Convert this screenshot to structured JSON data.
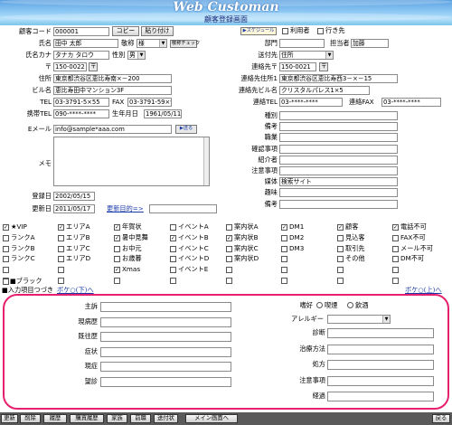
{
  "header": {
    "app_title": "Web Customan",
    "screen_title": "顧客登録画面"
  },
  "customer": {
    "code_label": "顧客コード",
    "code": "000001",
    "copy_button": "コピー",
    "paste_button": "貼り付け",
    "name_label": "氏名",
    "name": "田中 太郎",
    "honorific_label": "敬称",
    "honorific": "様",
    "honorific_check_button": "敬称チェック",
    "kana_label": "氏名カナ",
    "kana": "タナカ タロウ",
    "gender_label": "性別",
    "gender": "男",
    "postal_mark": "〒",
    "postal": "150-0022",
    "postal_button": "〒",
    "address_label": "住所",
    "address": "東京都渋谷区恵比寿南×－200",
    "building_label": "ビル名",
    "building": "恵比寿田中マンション3F",
    "tel_label": "TEL",
    "tel": "03-3791-5×55",
    "fax_label": "FAX",
    "fax": "03-3791-59×9",
    "mobile_label": "携帯TEL",
    "mobile": "090-****-****",
    "birthday_label": "生年月日",
    "birthday": "1961/05/11",
    "email_label": "Eメール",
    "email": "info@sample*aaa.com",
    "email_button": "▶送る",
    "memo_label": "メモ",
    "memo": "",
    "registered_label": "登録日",
    "registered": "2002/05/15",
    "updated_label": "更新日",
    "updated": "2011/05/17",
    "update_purpose_link": "更新目的=>",
    "update_purpose": ""
  },
  "right": {
    "schedule_button": "▶スケジュール",
    "user_checkbox": "利用者",
    "destination_checkbox": "行き先",
    "department_label": "部門",
    "department": "",
    "staff_label": "担当者",
    "staff": "加藤",
    "delivery_label": "送付先",
    "delivery": "住所",
    "contact_postal_label": "連絡先〒",
    "contact_postal": "150-0021",
    "contact_postal_button": "〒",
    "contact_address_label": "連絡先住所1",
    "contact_address": "東京都渋谷区恵比寿西3－×－15",
    "contact_building_label": "連絡先ビル名",
    "contact_building": "クリスタルパレス1×5",
    "contact_tel_label": "連絡TEL",
    "contact_tel": "03-****-****",
    "contact_fax_label": "連絡FAX",
    "contact_fax": "03-****-****",
    "fields": [
      {
        "label": "種別",
        "value": ""
      },
      {
        "label": "備考",
        "value": ""
      },
      {
        "label": "職業",
        "value": ""
      },
      {
        "label": "確認事項",
        "value": ""
      },
      {
        "label": "紹介者",
        "value": ""
      },
      {
        "label": "注意事項",
        "value": ""
      },
      {
        "label": "媒体",
        "value": "検索サイト"
      },
      {
        "label": "趣味",
        "value": ""
      },
      {
        "label": "備考",
        "value": ""
      }
    ]
  },
  "checks": [
    [
      {
        "label": "★VIP",
        "checked": true
      },
      {
        "label": "エリアA",
        "checked": true
      },
      {
        "label": "年賀状",
        "checked": true
      },
      {
        "label": "イベントA",
        "checked": false
      },
      {
        "label": "案内状A",
        "checked": false
      },
      {
        "label": "DM1",
        "checked": true
      },
      {
        "label": "顧客",
        "checked": true
      },
      {
        "label": "電話不可",
        "checked": true
      }
    ],
    [
      {
        "label": "ランクA",
        "checked": false
      },
      {
        "label": "エリアB",
        "checked": false
      },
      {
        "label": "暑中見舞",
        "checked": true
      },
      {
        "label": "イベントB",
        "checked": true
      },
      {
        "label": "案内状B",
        "checked": true
      },
      {
        "label": "DM2",
        "checked": false
      },
      {
        "label": "見込客",
        "checked": false
      },
      {
        "label": "FAX不可",
        "checked": false
      }
    ],
    [
      {
        "label": "ランクB",
        "checked": false
      },
      {
        "label": "エリアC",
        "checked": false
      },
      {
        "label": "お中元",
        "checked": false
      },
      {
        "label": "イベントC",
        "checked": false
      },
      {
        "label": "案内状C",
        "checked": false
      },
      {
        "label": "DM3",
        "checked": false
      },
      {
        "label": "取引先",
        "checked": false
      },
      {
        "label": "メール不可",
        "checked": false
      }
    ],
    [
      {
        "label": "ランクC",
        "checked": false
      },
      {
        "label": "エリアD",
        "checked": false
      },
      {
        "label": "お歳暮",
        "checked": false
      },
      {
        "label": "イベントD",
        "checked": false
      },
      {
        "label": "案内状D",
        "checked": false
      },
      {
        "label": "",
        "checked": false
      },
      {
        "label": "その他",
        "checked": false
      },
      {
        "label": "DM不可",
        "checked": false
      }
    ],
    [
      {
        "label": "",
        "checked": false
      },
      {
        "label": "",
        "checked": false
      },
      {
        "label": "Xmas",
        "checked": true
      },
      {
        "label": "イベントE",
        "checked": false
      },
      {
        "label": "",
        "checked": false
      },
      {
        "label": "",
        "checked": false
      },
      {
        "label": "",
        "checked": false
      },
      {
        "label": "",
        "checked": false
      }
    ],
    [
      {
        "label": "",
        "checked": false
      },
      {
        "label": "",
        "checked": false
      },
      {
        "label": "",
        "checked": false
      },
      {
        "label": "",
        "checked": false
      },
      {
        "label": "",
        "checked": false
      },
      {
        "label": "",
        "checked": false
      },
      {
        "label": "",
        "checked": false
      },
      {
        "label": "",
        "checked": false
      }
    ]
  ],
  "black_checkbox": "■ブラック",
  "input_section": {
    "title": "■入力項目つづき",
    "link_left": "ボケ○(下)へ",
    "link_right": "ボケ○(上)へ"
  },
  "medical": {
    "left": [
      {
        "label": "主訴",
        "value": ""
      },
      {
        "label": "現病歴",
        "value": ""
      },
      {
        "label": "既往歴",
        "value": ""
      },
      {
        "label": "症状",
        "value": ""
      },
      {
        "label": "現症",
        "value": ""
      },
      {
        "label": "望診",
        "value": ""
      }
    ],
    "preference_label": "嗜好",
    "preference_options": [
      "喫煙",
      "飲酒"
    ],
    "allergy_label": "アレルギー",
    "allergy": "",
    "right": [
      {
        "label": "診断",
        "value": ""
      },
      {
        "label": "治療方法",
        "value": ""
      },
      {
        "label": "処方",
        "value": ""
      },
      {
        "label": "注意事項",
        "value": ""
      },
      {
        "label": "経過",
        "value": ""
      }
    ]
  },
  "bottom_buttons": [
    "更新",
    "削除",
    "履歴",
    "購買履歴",
    "家族",
    "前職",
    "送付状",
    "メイン画面へ",
    "戻る"
  ]
}
